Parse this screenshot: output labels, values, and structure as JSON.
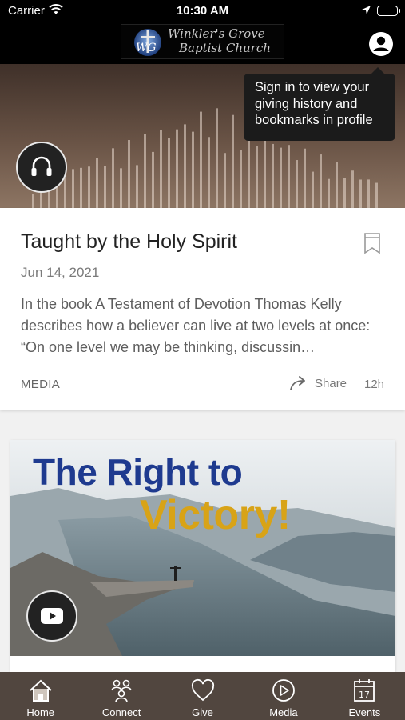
{
  "status_bar": {
    "carrier": "Carrier",
    "time": "10:30 AM"
  },
  "header": {
    "logo_line1": "Winkler's Grove",
    "logo_line2": "Baptist Church",
    "logo_monogram": "WG"
  },
  "tooltip": {
    "text": "Sign in to view your giving history and bookmarks in profile"
  },
  "card1": {
    "title": "Taught by the Holy Spirit",
    "date": "Jun 14, 2021",
    "description": "In the book A Testament of Devotion Thomas Kelly describes how a believer can live at two levels at once: “On one level we may be thinking, discussin…",
    "type": "MEDIA",
    "share_label": "Share",
    "age": "12h",
    "icon": "headphones-icon"
  },
  "card2": {
    "title_line1": "The Right to",
    "title_line2": "Victory!",
    "icon": "youtube-play-icon"
  },
  "tabs": [
    {
      "label": "Home",
      "icon": "home-icon"
    },
    {
      "label": "Connect",
      "icon": "people-icon"
    },
    {
      "label": "Give",
      "icon": "heart-icon"
    },
    {
      "label": "Media",
      "icon": "play-circle-icon"
    },
    {
      "label": "Events",
      "icon": "calendar-icon"
    }
  ],
  "colors": {
    "header_bg": "#000000",
    "tabbar_bg": "#51463f",
    "tooltip_bg": "#1b1b1b",
    "title_blue": "#1e3a8f",
    "title_gold": "#d8a317"
  }
}
